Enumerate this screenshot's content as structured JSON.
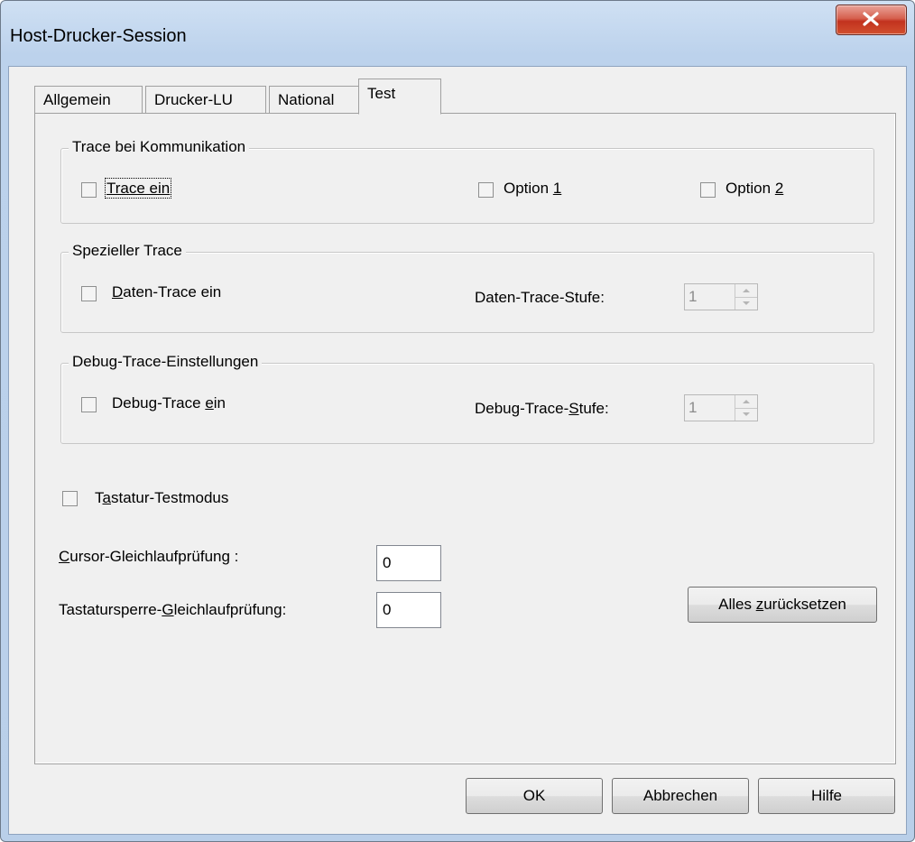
{
  "window": {
    "title": "Host-Drucker-Session",
    "close_icon": "close-icon",
    "accent": "#c2321e"
  },
  "tabs": [
    {
      "label": "Allgemein",
      "active": false
    },
    {
      "label": "Drucker-LU",
      "active": false
    },
    {
      "label": "National",
      "active": false
    },
    {
      "label": "Test",
      "active": true
    }
  ],
  "group_comm": {
    "legend": "Trace bei Kommunikation",
    "trace_ein": {
      "label": "Trace ein",
      "checked": false
    },
    "option1": {
      "prefix": "Option ",
      "underlined": "1",
      "checked": false
    },
    "option2": {
      "prefix": "Option ",
      "underlined": "2",
      "checked": false
    }
  },
  "group_special": {
    "legend": "Spezieller Trace",
    "daten_trace": {
      "underlined": "D",
      "rest": "aten-Trace ein",
      "checked": false
    },
    "stufe_label": "Daten-Trace-Stufe:",
    "stufe_value": "1"
  },
  "group_debug": {
    "legend": "Debug-Trace-Einstellungen",
    "debug_trace": {
      "prefix": "Debug-Trace ",
      "underlined": "e",
      "rest": "in",
      "checked": false
    },
    "stufe_prefix": "Debug-Trace-",
    "stufe_underlined": "S",
    "stufe_rest": "tufe:",
    "stufe_value": "1"
  },
  "tastatur": {
    "prefix": "T",
    "underlined": "a",
    "rest": "statur-Testmodus",
    "checked": false
  },
  "cursor": {
    "underlined": "C",
    "rest": "ursor-Gleichlaufprüfung :",
    "value": "0"
  },
  "sperre": {
    "prefix": "Tastatursperre-",
    "underlined": "G",
    "rest": "leichlaufprüfung:",
    "value": "0"
  },
  "reset_button": {
    "prefix": "Alles ",
    "underlined": "z",
    "rest": "urücksetzen"
  },
  "footer": {
    "ok": "OK",
    "cancel": "Abbrechen",
    "help": "Hilfe"
  }
}
